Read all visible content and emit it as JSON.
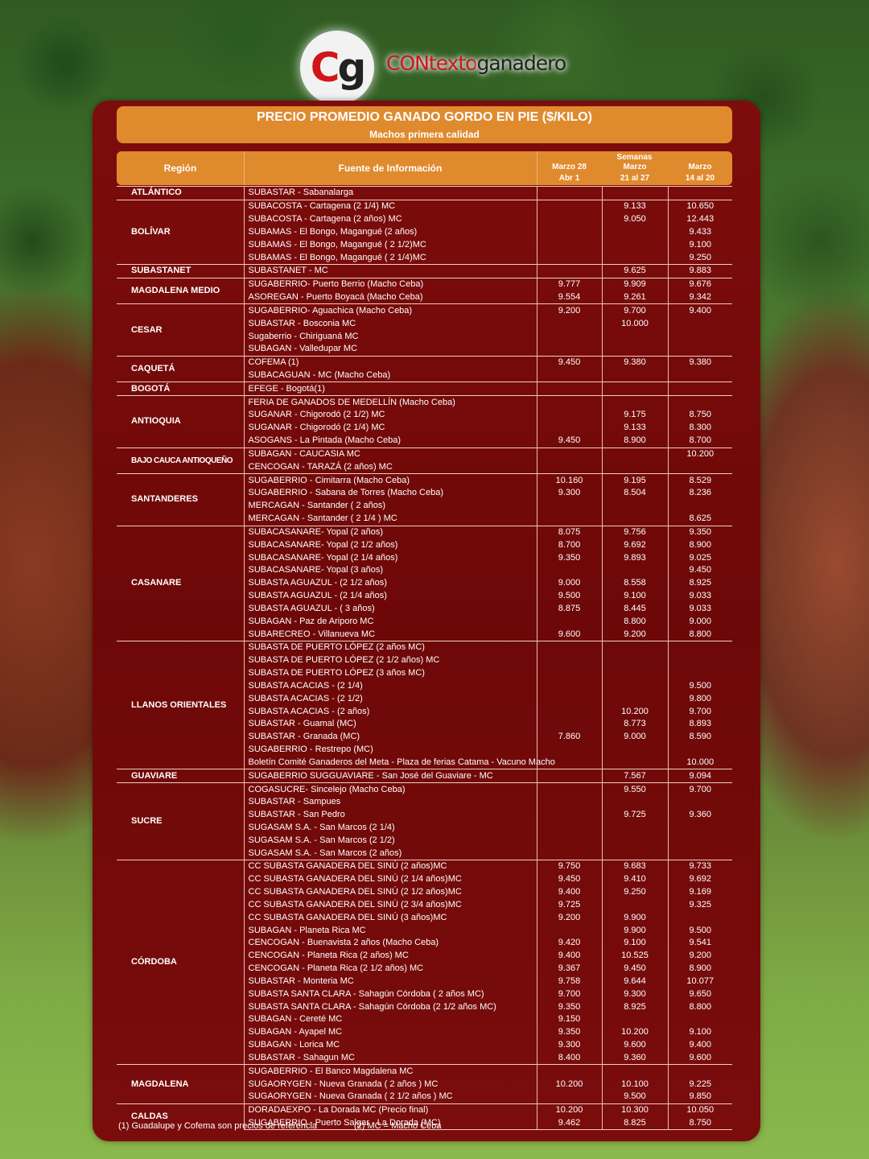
{
  "brand": {
    "logo_c": "C",
    "logo_g": "g",
    "name_a": "CONtexto",
    "name_b": "ganadero",
    "accent": "#d0161a"
  },
  "title": "PRECIO PROMEDIO GANADO GORDO EN PIE ($/KILO)",
  "subtitle": "Machos primera calidad",
  "headers": {
    "region": "Región",
    "source": "Fuente de Información",
    "weeks": "Semanas",
    "col1a": "Marzo 28",
    "col1b": "Abr 1",
    "col2a": "Marzo",
    "col2b": "21 al 27",
    "col3a": "Marzo",
    "col3b": "14 al 20"
  },
  "regions": [
    {
      "name": "ATLÁNTICO",
      "rows": [
        [
          "SUBASTAR - Sabanalarga",
          "",
          "",
          ""
        ]
      ]
    },
    {
      "name": "BOLÍVAR",
      "rows": [
        [
          "SUBACOSTA - Cartagena (2 1/4) MC",
          "",
          "9.133",
          "10.650"
        ],
        [
          "SUBACOSTA - Cartagena (2 años) MC",
          "",
          "9.050",
          "12.443"
        ],
        [
          "SUBAMAS - El Bongo, Magangué (2 años)",
          "",
          "",
          "9.433"
        ],
        [
          "SUBAMAS - El Bongo, Magangué ( 2 1/2)MC",
          "",
          "",
          "9.100"
        ],
        [
          "SUBAMAS - El Bongo, Magangué ( 2 1/4)MC",
          "",
          "",
          "9.250"
        ]
      ]
    },
    {
      "name": "SUBASTANET",
      "rows": [
        [
          "SUBASTANET - MC",
          "",
          "9.625",
          "9.883"
        ]
      ]
    },
    {
      "name": "MAGDALENA MEDIO",
      "rows": [
        [
          "SUGABERRIO- Puerto Berrio (Macho Ceba)",
          "9.777",
          "9.909",
          "9.676"
        ],
        [
          "ASOREGAN - Puerto Boyacá (Macho Ceba)",
          "9.554",
          "9.261",
          "9.342"
        ]
      ]
    },
    {
      "name": "CESAR",
      "rows": [
        [
          "SUGABERRIO- Aguachica  (Macho Ceba)",
          "9.200",
          "9.700",
          "9.400"
        ],
        [
          "SUBASTAR - Bosconia MC",
          "",
          "10.000",
          ""
        ],
        [
          "Sugaberrio - Chiriguaná MC",
          "",
          "",
          ""
        ],
        [
          "SUBAGAN - Valledupar MC",
          "",
          "",
          ""
        ]
      ]
    },
    {
      "name": "CAQUETÁ",
      "rows": [
        [
          "COFEMA (1)",
          "9.450",
          "9.380",
          "9.380"
        ],
        [
          "SUBACAGUAN - MC (Macho Ceba)",
          "",
          "",
          ""
        ]
      ]
    },
    {
      "name": "BOGOTÁ",
      "rows": [
        [
          "EFEGE - Bogotá(1)",
          "",
          "",
          ""
        ]
      ]
    },
    {
      "name": "ANTIOQUIA",
      "rows": [
        [
          "FERIA DE GANADOS DE MEDELLÍN (Macho Ceba)",
          "",
          "",
          ""
        ],
        [
          "SUGANAR - Chigorodó (2 1/2) MC",
          "",
          "9.175",
          "8.750"
        ],
        [
          "SUGANAR - Chigorodó (2 1/4) MC",
          "",
          "9.133",
          "8.300"
        ],
        [
          "ASOGANS - La Pintada (Macho Ceba)",
          "9.450",
          "8.900",
          "8.700"
        ]
      ]
    },
    {
      "name": "BAJO CAUCA ANTIOQUEÑO",
      "rows": [
        [
          "SUBAGAN - CAUCASIA MC",
          "",
          "",
          "10.200"
        ],
        [
          "CENCOGAN - TARAZÁ (2 años) MC",
          "",
          "",
          ""
        ]
      ]
    },
    {
      "name": "SANTANDERES",
      "rows": [
        [
          "SUGABERRIO - Cimitarra (Macho Ceba)",
          "10.160",
          "9.195",
          "8.529"
        ],
        [
          "SUGABERRIO - Sabana de Torres (Macho Ceba)",
          "9.300",
          "8.504",
          "8.236"
        ],
        [
          "MERCAGAN - Santander ( 2 años)",
          "",
          "",
          ""
        ],
        [
          "MERCAGAN - Santander ( 2 1/4 ) MC",
          "",
          "",
          "8.625"
        ]
      ]
    },
    {
      "name": "CASANARE",
      "rows": [
        [
          "SUBACASANARE- Yopal (2 años)",
          "8.075",
          "9.756",
          "9.350"
        ],
        [
          "SUBACASANARE- Yopal (2 1/2 años)",
          "8.700",
          "9.692",
          "8.900"
        ],
        [
          "SUBACASANARE- Yopal (2 1/4 años)",
          "9.350",
          "9.893",
          "9.025"
        ],
        [
          "SUBACASANARE- Yopal (3 años)",
          "",
          "",
          "9.450"
        ],
        [
          "SUBASTA AGUAZUL - (2 1/2 años)",
          "9.000",
          "8.558",
          "8.925"
        ],
        [
          "SUBASTA AGUAZUL - (2 1/4 años)",
          "9.500",
          "9.100",
          "9.033"
        ],
        [
          "SUBASTA AGUAZUL - ( 3 años)",
          "8.875",
          "8.445",
          "9.033"
        ],
        [
          "SUBAGAN - Paz de Ariporo MC",
          "",
          "8.800",
          "9.000"
        ],
        [
          "SUBARECREO - Villanueva MC",
          "9.600",
          "9.200",
          "8.800"
        ]
      ]
    },
    {
      "name": "LLANOS ORIENTALES",
      "rows": [
        [
          "SUBASTA DE PUERTO LÓPEZ (2 años MC)",
          "",
          "",
          ""
        ],
        [
          "SUBASTA DE PUERTO LÓPEZ (2 1/2 años) MC",
          "",
          "",
          ""
        ],
        [
          "SUBASTA DE PUERTO LÓPEZ (3 años MC)",
          "",
          "",
          ""
        ],
        [
          "SUBASTA ACACIAS -  (2 1/4)",
          "",
          "",
          "9.500"
        ],
        [
          "SUBASTA ACACIAS - (2 1/2)",
          "",
          "",
          "9.800"
        ],
        [
          "SUBASTA ACACIAS - (2 años)",
          "",
          "10.200",
          "9.700"
        ],
        [
          "SUBASTAR - Guamal (MC)",
          "",
          "8.773",
          "8.893"
        ],
        [
          "SUBASTAR - Granada (MC)",
          "7.860",
          "9.000",
          "8.590"
        ],
        [
          "SUGABERRIO - Restrepo (MC)",
          "",
          "",
          ""
        ],
        [
          "Boletín Comité Ganaderos del Meta - Plaza de ferias Catama - Vacuno Macho",
          "",
          "",
          "10.000"
        ]
      ]
    },
    {
      "name": "GUAVIARE",
      "rows": [
        [
          "SUGABERRIO SUGGUAVIARE - San José del Guaviare - MC",
          "",
          "7.567",
          "9.094"
        ]
      ]
    },
    {
      "name": "SUCRE",
      "rows": [
        [
          "COGASUCRE- Sincelejo (Macho Ceba)",
          "",
          "9.550",
          "9.700"
        ],
        [
          "SUBASTAR - Sampues",
          "",
          "",
          ""
        ],
        [
          "SUBASTAR - San Pedro",
          "",
          "9.725",
          "9.360"
        ],
        [
          "SUGASAM S.A. - San Marcos (2 1/4)",
          "",
          "",
          ""
        ],
        [
          "SUGASAM S.A. - San Marcos (2 1/2)",
          "",
          "",
          ""
        ],
        [
          "SUGASAM S.A. - San Marcos (2 años)",
          "",
          "",
          ""
        ]
      ]
    },
    {
      "name": "CÓRDOBA",
      "rows": [
        [
          "CC SUBASTA GANADERA DEL SINÚ (2 años)MC",
          "9.750",
          "9.683",
          "9.733"
        ],
        [
          "CC SUBASTA GANADERA DEL SINÚ (2 1/4 años)MC",
          "9.450",
          "9.410",
          "9.692"
        ],
        [
          "CC SUBASTA GANADERA DEL SINÚ (2 1/2 años)MC",
          "9.400",
          "9.250",
          "9.169"
        ],
        [
          "CC SUBASTA GANADERA DEL SINÚ (2 3/4 años)MC",
          "9.725",
          "",
          "9.325"
        ],
        [
          "CC SUBASTA GANADERA DEL SINÚ (3 años)MC",
          "9.200",
          "9.900",
          ""
        ],
        [
          "SUBAGAN - Planeta Rica MC",
          "",
          "9.900",
          "9.500"
        ],
        [
          "CENCOGAN - Buenavista 2 años (Macho Ceba)",
          "9.420",
          "9.100",
          "9.541"
        ],
        [
          "CENCOGAN - Planeta Rica (2 años) MC",
          "9.400",
          "10.525",
          "9.200"
        ],
        [
          "CENCOGAN - Planeta Rica (2 1/2 años) MC",
          "9.367",
          "9.450",
          "8.900"
        ],
        [
          "SUBASTAR - Monteria MC",
          "9.758",
          "9.644",
          "10.077"
        ],
        [
          "SUBASTA SANTA CLARA - Sahagún Córdoba ( 2 años MC)",
          "9.700",
          "9.300",
          "9.650"
        ],
        [
          "SUBASTA SANTA CLARA - Sahagún Córdoba (2 1/2 años MC)",
          "9.350",
          "8.925",
          "8.800"
        ],
        [
          "SUBAGAN - Cereté MC",
          "9.150",
          "",
          ""
        ],
        [
          "SUBAGAN - Ayapel MC",
          "9.350",
          "10.200",
          "9.100"
        ],
        [
          "SUBAGAN - Lorica MC",
          "9.300",
          "9.600",
          "9.400"
        ],
        [
          "SUBASTAR - Sahagun MC",
          "8.400",
          "9.360",
          "9.600"
        ]
      ]
    },
    {
      "name": "MAGDALENA",
      "rows": [
        [
          "SUGABERRIO - El Banco Magdalena MC",
          "",
          "",
          ""
        ],
        [
          "SUGAORYGEN - Nueva Granada ( 2 años ) MC",
          "10.200",
          "10.100",
          "9.225"
        ],
        [
          "SUGAORYGEN - Nueva Granada ( 2 1/2 años ) MC",
          "",
          "9.500",
          "9.850"
        ]
      ]
    },
    {
      "name": "CALDAS",
      "rows": [
        [
          "DORADAEXPO - La Dorada MC (Precio final)",
          "10.200",
          "10.300",
          "10.050"
        ],
        [
          "SUGABERRIO - Puerto Salgar - La Dorada (MC)",
          "9.462",
          "8.825",
          "8.750"
        ]
      ]
    }
  ],
  "footnotes": [
    "(1) Guadalupe y Cofema son precios de referencia",
    "(2) MC = Macho Ceba"
  ]
}
